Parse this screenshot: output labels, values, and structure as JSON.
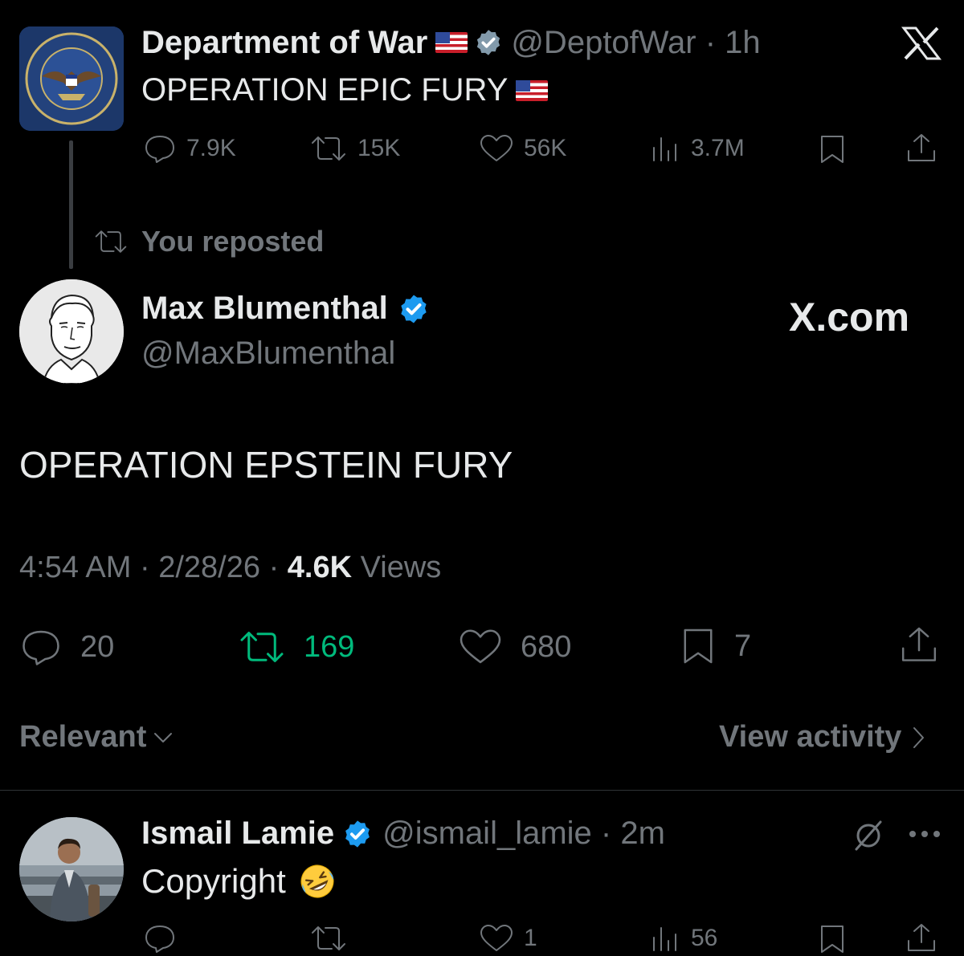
{
  "quoted_post": {
    "author_name": "Department of War",
    "handle": "@DeptofWar",
    "time": "1h",
    "text": "OPERATION EPIC FURY",
    "stats": {
      "replies": "7.9K",
      "reposts": "15K",
      "likes": "56K",
      "views": "3.7M"
    }
  },
  "repost_banner": "You reposted",
  "main_post": {
    "author_name": "Max Blumenthal",
    "handle": "@MaxBlumenthal",
    "watermark": "X.com",
    "text": "OPERATION EPSTEIN FURY",
    "time": "4:54 AM",
    "date": "2/28/26",
    "views_count": "4.6K",
    "views_label": "Views",
    "stats": {
      "replies": "20",
      "reposts": "169",
      "likes": "680",
      "bookmarks": "7"
    }
  },
  "replies_sort": {
    "label": "Relevant",
    "activity_link": "View activity"
  },
  "reply": {
    "author_name": "Ismail Lamie",
    "handle": "@ismail_lamie",
    "time": "2m",
    "text": "Copyright",
    "stats": {
      "likes": "1",
      "views": "56"
    }
  },
  "colors": {
    "background": "#000000",
    "text": "#e7e9ea",
    "muted": "#71767b",
    "verified": "#1d9bf0",
    "repost_active": "#00ba7c"
  },
  "icons": [
    "x-logo-icon",
    "verified-badge-icon",
    "reply-icon",
    "repost-icon",
    "like-icon",
    "views-icon",
    "bookmark-icon",
    "share-icon",
    "grok-icon",
    "more-icon",
    "chevron-down-icon",
    "chevron-right-icon",
    "us-flag-icon",
    "rofl-emoji-icon"
  ]
}
